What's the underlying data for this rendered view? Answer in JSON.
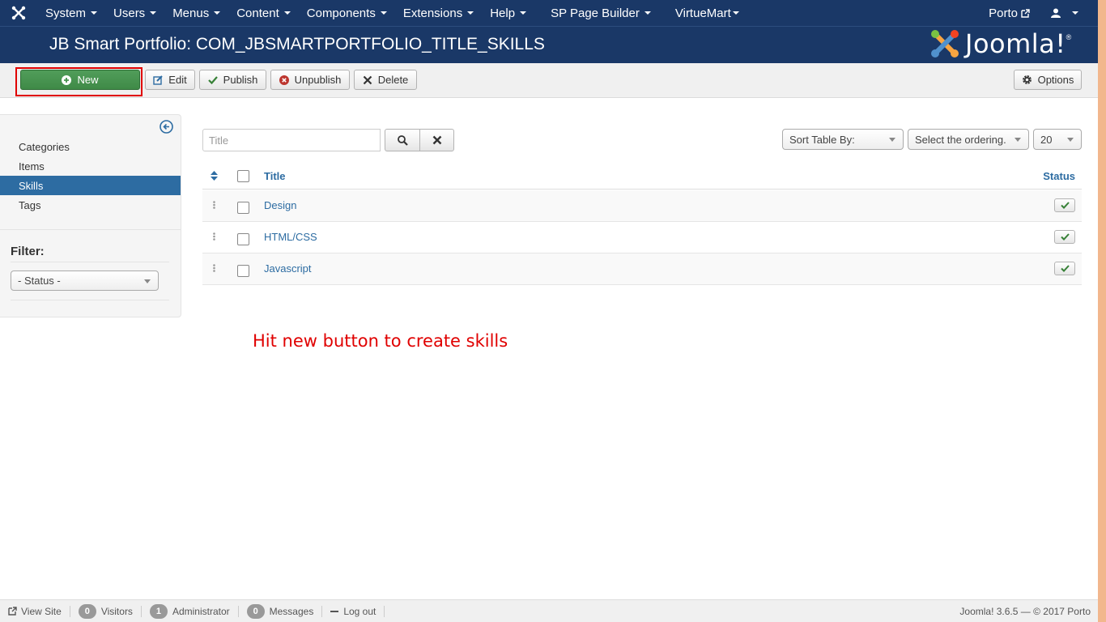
{
  "topnav": {
    "menu": [
      "System",
      "Users",
      "Menus",
      "Content",
      "Components",
      "Extensions",
      "Help",
      "SP Page Builder",
      "VirtueMart"
    ],
    "site_link": "Porto"
  },
  "header": {
    "title": "JB Smart Portfolio: COM_JBSMARTPORTFOLIO_TITLE_SKILLS",
    "brand": "Joomla!"
  },
  "toolbar": {
    "new_label": "New",
    "edit_label": "Edit",
    "publish_label": "Publish",
    "unpublish_label": "Unpublish",
    "delete_label": "Delete",
    "options_label": "Options"
  },
  "sidebar": {
    "items": [
      {
        "label": "Categories",
        "active": false
      },
      {
        "label": "Items",
        "active": false
      },
      {
        "label": "Skills",
        "active": true
      },
      {
        "label": "Tags",
        "active": false
      }
    ],
    "filter_label": "Filter:",
    "status_filter": "- Status -"
  },
  "search": {
    "placeholder": "Title",
    "sort_by": "Sort Table By:",
    "ordering": "Select the ordering.",
    "limit": "20"
  },
  "table": {
    "columns": {
      "title": "Title",
      "status": "Status"
    },
    "rows": [
      {
        "title": "Design",
        "published": true
      },
      {
        "title": "HTML/CSS",
        "published": true
      },
      {
        "title": "Javascript",
        "published": true
      }
    ]
  },
  "annotation": "Hit new button to create skills",
  "statusbar": {
    "view_site": "View Site",
    "visitors_count": "0",
    "visitors_label": "Visitors",
    "admin_count": "1",
    "admin_label": "Administrator",
    "messages_count": "0",
    "messages_label": "Messages",
    "logout": "Log out",
    "copyright": "Joomla! 3.6.5 — © 2017 Porto"
  },
  "colors": {
    "nav_bg": "#1a3867",
    "accent": "#2d6ca2",
    "new_button": "#46934e",
    "annotation": "#e00000"
  }
}
